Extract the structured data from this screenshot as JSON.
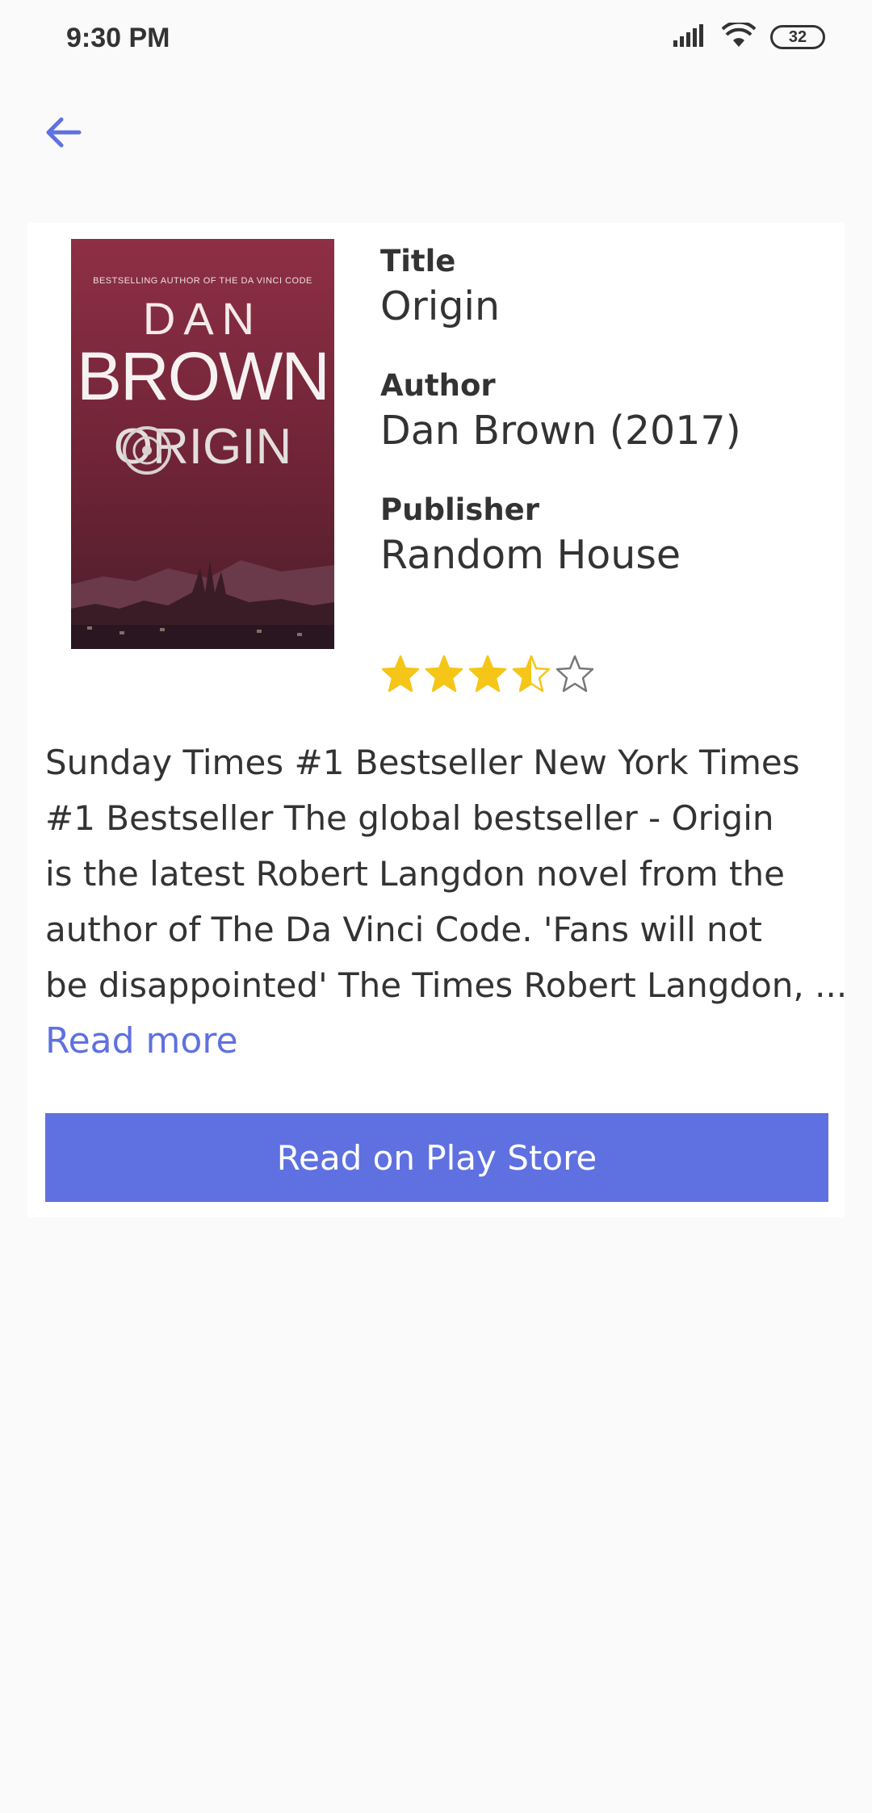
{
  "status_bar": {
    "time": "9:30 PM",
    "battery": "32"
  },
  "book": {
    "cover": {
      "tagline": "BESTSELLING AUTHOR OF THE DA VINCI CODE",
      "author_first": "DAN",
      "author_last": "BROWN",
      "title": "ORIGIN"
    },
    "title_label": "Title",
    "title": "Origin",
    "author_label": "Author",
    "author": "Dan Brown (2017)",
    "publisher_label": "Publisher",
    "publisher": "Random House",
    "rating": 3.5,
    "rating_max": 5,
    "description_lines": [
      "Sunday Times #1 Bestseller New York Times",
      "#1 Bestseller The global bestseller - Origin",
      "is the latest Robert Langdon novel from the",
      "author of The Da Vinci Code. 'Fans will not",
      "be disappointed' The Times Robert Langdon, ..."
    ],
    "read_more": "Read more",
    "play_store_button": "Read on Play Store"
  },
  "colors": {
    "accent": "#5f71e0",
    "star": "#f5c518",
    "background": "#fafafa",
    "card": "#ffffff"
  }
}
